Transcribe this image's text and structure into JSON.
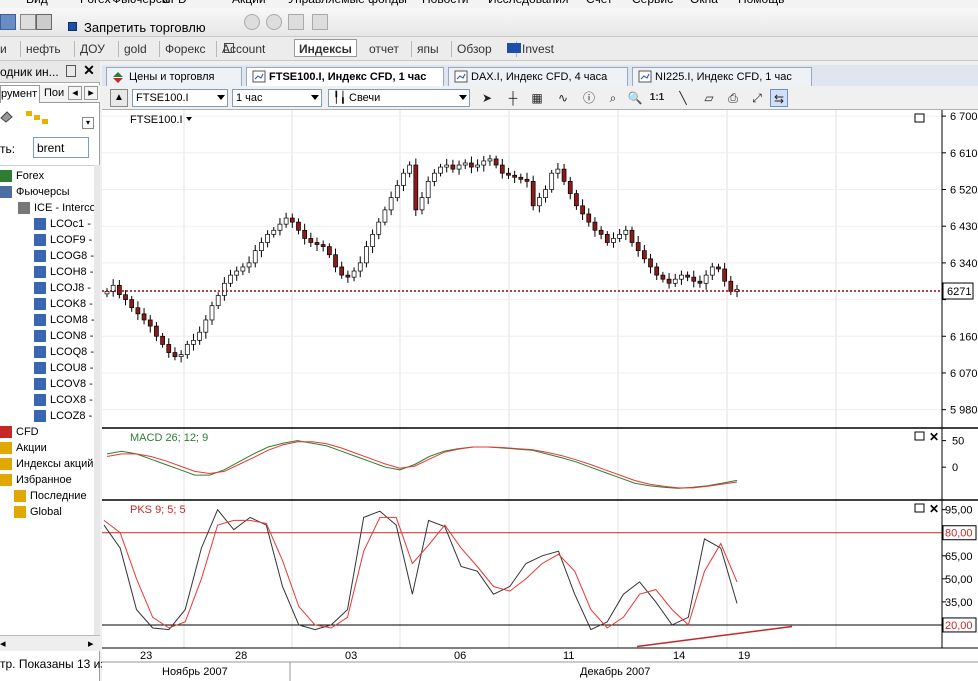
{
  "menu": [
    "Вид",
    "Forex",
    "Фьючерсы",
    "CFD",
    "Акции",
    "Управляемые фонды",
    "Новости",
    "Исследования",
    "Счет",
    "Сервис",
    "Окна",
    "Помощь"
  ],
  "toolbar": {
    "ban_trading_label": "Запретить торговлю"
  },
  "quick_tabs": [
    "и",
    "нефть",
    "ДОУ",
    "gold",
    "Форекс",
    "Account",
    "Индексы",
    "отчет",
    "япы",
    "Обзор",
    "Invest"
  ],
  "left_panel": {
    "title": "одник ин...",
    "tabs": [
      "румент",
      "Пои"
    ],
    "search_label": "ть:",
    "search_value": "brent",
    "tree": [
      {
        "label": "Forex",
        "icon": "forex-icon"
      },
      {
        "label": "Фьючерсы",
        "icon": "futures-icon"
      },
      {
        "label": "ICE - Interco",
        "icon": "exchange-icon"
      },
      {
        "label": "LCOc1 -",
        "icon": "instrument-icon"
      },
      {
        "label": "LCOF9 -",
        "icon": "instrument-icon"
      },
      {
        "label": "LCOG8 -",
        "icon": "instrument-icon"
      },
      {
        "label": "LCOH8 -",
        "icon": "instrument-icon"
      },
      {
        "label": "LCOJ8 -",
        "icon": "instrument-icon"
      },
      {
        "label": "LCOK8 -",
        "icon": "instrument-icon"
      },
      {
        "label": "LCOM8 -",
        "icon": "instrument-icon"
      },
      {
        "label": "LCON8 -",
        "icon": "instrument-icon"
      },
      {
        "label": "LCOQ8 -",
        "icon": "instrument-icon"
      },
      {
        "label": "LCOU8 -",
        "icon": "instrument-icon"
      },
      {
        "label": "LCOV8 -",
        "icon": "instrument-icon"
      },
      {
        "label": "LCOX8 -",
        "icon": "instrument-icon"
      },
      {
        "label": "LCOZ8 -",
        "icon": "instrument-icon"
      },
      {
        "label": "CFD",
        "icon": "cfd-icon"
      },
      {
        "label": "Акции",
        "icon": "stocks-icon"
      },
      {
        "label": "Индексы акций",
        "icon": "indices-icon"
      },
      {
        "label": "Избранное",
        "icon": "favorites-icon"
      },
      {
        "label": "Последние",
        "icon": "folder-icon"
      },
      {
        "label": "Global",
        "icon": "folder-icon"
      }
    ],
    "status": "тр. Показаны 13 из"
  },
  "chart_tabs": [
    {
      "label": "Цены и торговля",
      "active": false
    },
    {
      "label": "FTSE100.I, Индекс CFD, 1 час",
      "active": true
    },
    {
      "label": "DAX.I, Индекс CFD, 4 часа",
      "active": false
    },
    {
      "label": "NI225.I, Индекс CFD, 1 час",
      "active": false
    }
  ],
  "chart_toolbar": {
    "instrument": "FTSE100.I",
    "timeframe": "1 час",
    "chart_type": "Свечи",
    "zoom_label": "1:1"
  },
  "colors": {
    "bull": "#ffffff",
    "bear": "#8b1a1a",
    "macd_main": "#2e7d32",
    "macd_signal": "#e53935",
    "stoch_k": "#333333",
    "stoch_d": "#e53935",
    "level_line": "#c62828",
    "price_line": "#a00000"
  },
  "chart_data": [
    {
      "type": "candlestick",
      "title": "FTSE100.I",
      "y_ticks": [
        6700,
        6610,
        6520,
        6430,
        6340,
        6250,
        6160,
        6070,
        5980
      ],
      "y_tick_labels": [
        "6 700",
        "6 610",
        "6 520",
        "6 430",
        "6 340",
        "",
        "6 160",
        "6 070",
        "5 980"
      ],
      "current_price": 6271,
      "current_price_label": "6271",
      "x_tick_labels": [
        "23",
        "28",
        "03",
        "06",
        "11",
        "14",
        "19"
      ],
      "month_labels": [
        "Ноябрь 2007",
        "Декабрь 2007"
      ],
      "close_path": [
        6270,
        6285,
        6262,
        6250,
        6230,
        6215,
        6200,
        6185,
        6160,
        6140,
        6120,
        6110,
        6115,
        6140,
        6150,
        6170,
        6200,
        6235,
        6260,
        6290,
        6310,
        6320,
        6330,
        6340,
        6370,
        6390,
        6410,
        6420,
        6435,
        6450,
        6440,
        6420,
        6400,
        6390,
        6385,
        6380,
        6360,
        6330,
        6310,
        6305,
        6320,
        6340,
        6380,
        6410,
        6440,
        6470,
        6500,
        6530,
        6560,
        6580,
        6470,
        6500,
        6540,
        6560,
        6575,
        6580,
        6570,
        6580,
        6585,
        6575,
        6580,
        6590,
        6595,
        6580,
        6560,
        6555,
        6550,
        6545,
        6540,
        6480,
        6500,
        6520,
        6560,
        6570,
        6540,
        6510,
        6480,
        6460,
        6440,
        6420,
        6410,
        6390,
        6400,
        6410,
        6420,
        6390,
        6370,
        6350,
        6330,
        6310,
        6300,
        6290,
        6300,
        6310,
        6305,
        6295,
        6290,
        6310,
        6330,
        6325,
        6295,
        6270,
        6275
      ]
    },
    {
      "type": "line",
      "title": "MACD 26; 12; 9",
      "y_ticks": [
        50,
        0
      ],
      "y_tick_labels": [
        "50",
        "0"
      ],
      "series": [
        {
          "name": "main",
          "values": [
            25,
            30,
            25,
            15,
            5,
            -5,
            -15,
            -15,
            -5,
            10,
            25,
            38,
            45,
            50,
            45,
            40,
            30,
            20,
            10,
            0,
            -5,
            5,
            20,
            30,
            35,
            38,
            38,
            36,
            34,
            32,
            25,
            18,
            10,
            0,
            -10,
            -20,
            -30,
            -35,
            -38,
            -40,
            -38,
            -35,
            -30,
            -25
          ]
        },
        {
          "name": "signal",
          "values": [
            20,
            25,
            25,
            20,
            12,
            2,
            -8,
            -12,
            -8,
            5,
            18,
            32,
            42,
            48,
            48,
            44,
            36,
            26,
            16,
            6,
            -2,
            2,
            15,
            28,
            34,
            38,
            38,
            37,
            35,
            33,
            28,
            22,
            14,
            5,
            -5,
            -15,
            -25,
            -32,
            -36,
            -39,
            -39,
            -36,
            -32,
            -28
          ]
        }
      ]
    },
    {
      "type": "line",
      "title": "PKS 9; 5; 5",
      "y_ticks": [
        95,
        80,
        65,
        50,
        35,
        20
      ],
      "y_tick_labels": [
        "95,00",
        "80,00",
        "65,00",
        "50,00",
        "35,00",
        "20,00"
      ],
      "levels": [
        80,
        20
      ],
      "series": [
        {
          "name": "K",
          "values": [
            85,
            70,
            30,
            18,
            17,
            30,
            70,
            95,
            82,
            90,
            85,
            45,
            20,
            17,
            20,
            30,
            90,
            94,
            85,
            40,
            88,
            84,
            58,
            55,
            40,
            45,
            60,
            65,
            68,
            40,
            17,
            22,
            40,
            48,
            35,
            20,
            25,
            76,
            70,
            34
          ]
        },
        {
          "name": "D",
          "values": [
            88,
            80,
            50,
            25,
            18,
            22,
            50,
            85,
            88,
            88,
            86,
            62,
            32,
            20,
            18,
            25,
            68,
            90,
            90,
            60,
            72,
            85,
            70,
            58,
            45,
            42,
            50,
            60,
            66,
            55,
            30,
            18,
            25,
            40,
            43,
            30,
            20,
            55,
            73,
            48
          ]
        }
      ]
    }
  ]
}
